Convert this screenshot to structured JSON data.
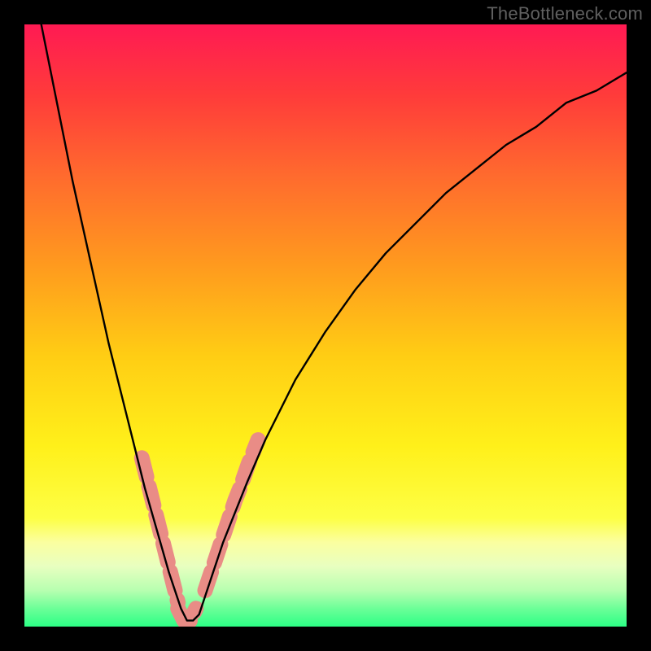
{
  "watermark": "TheBottleneck.com",
  "chart_data": {
    "type": "line",
    "title": "",
    "xlabel": "",
    "ylabel": "",
    "xlim": [
      0,
      100
    ],
    "ylim": [
      0,
      100
    ],
    "x_valley": 27,
    "curve_main": {
      "x": [
        0,
        2,
        4,
        6,
        8,
        10,
        12,
        14,
        16,
        18,
        20,
        22,
        24,
        25,
        26,
        27,
        28,
        29,
        30,
        31,
        32,
        33,
        35,
        37,
        40,
        45,
        50,
        55,
        60,
        65,
        70,
        75,
        80,
        85,
        90,
        95,
        100
      ],
      "y": [
        115,
        104,
        94,
        84,
        74,
        65,
        56,
        47,
        39,
        31,
        23,
        16,
        9,
        6,
        3,
        1,
        1,
        2,
        5,
        8,
        11,
        14,
        19,
        24,
        31,
        41,
        49,
        56,
        62,
        67,
        72,
        76,
        80,
        83,
        87,
        89,
        92
      ]
    },
    "overlay_segments": [
      {
        "x": [
          19.5,
          20,
          20.5,
          21,
          21.5,
          22,
          22.5,
          23,
          23.5,
          24,
          24.5,
          25,
          25.5
        ],
        "y": [
          28,
          26,
          24,
          22,
          20,
          18,
          16,
          14,
          12,
          10,
          8,
          6,
          4
        ]
      },
      {
        "x": [
          25.5,
          26,
          26.5,
          27,
          27.5,
          28,
          28.5
        ],
        "y": [
          3,
          2,
          1,
          1,
          1,
          2,
          3
        ]
      },
      {
        "x": [
          30,
          30.5,
          31,
          31.5,
          32,
          32.5,
          33,
          33.5,
          34,
          34.5,
          35,
          35.8,
          36.5,
          37.2,
          38,
          38.8
        ],
        "y": [
          6,
          7.5,
          9,
          10.5,
          12,
          13.5,
          15,
          16.5,
          18,
          19.5,
          21,
          23,
          25,
          27,
          29,
          31
        ]
      }
    ],
    "background": {
      "stops": [
        {
          "offset": 0.0,
          "color": "#ff1a53"
        },
        {
          "offset": 0.12,
          "color": "#ff3c3a"
        },
        {
          "offset": 0.25,
          "color": "#ff6a2e"
        },
        {
          "offset": 0.4,
          "color": "#ff9a1e"
        },
        {
          "offset": 0.55,
          "color": "#ffcd14"
        },
        {
          "offset": 0.7,
          "color": "#fff01a"
        },
        {
          "offset": 0.82,
          "color": "#fdff45"
        },
        {
          "offset": 0.86,
          "color": "#fbffa0"
        },
        {
          "offset": 0.9,
          "color": "#e8ffc0"
        },
        {
          "offset": 0.94,
          "color": "#b7ffb0"
        },
        {
          "offset": 0.97,
          "color": "#6cff98"
        },
        {
          "offset": 1.0,
          "color": "#2cff85"
        }
      ]
    },
    "overlay_style": {
      "stroke": "#e98c86",
      "stroke_width": 19,
      "dash": [
        24,
        12
      ]
    },
    "curve_style": {
      "stroke": "#000000",
      "stroke_width": 2.4
    }
  }
}
